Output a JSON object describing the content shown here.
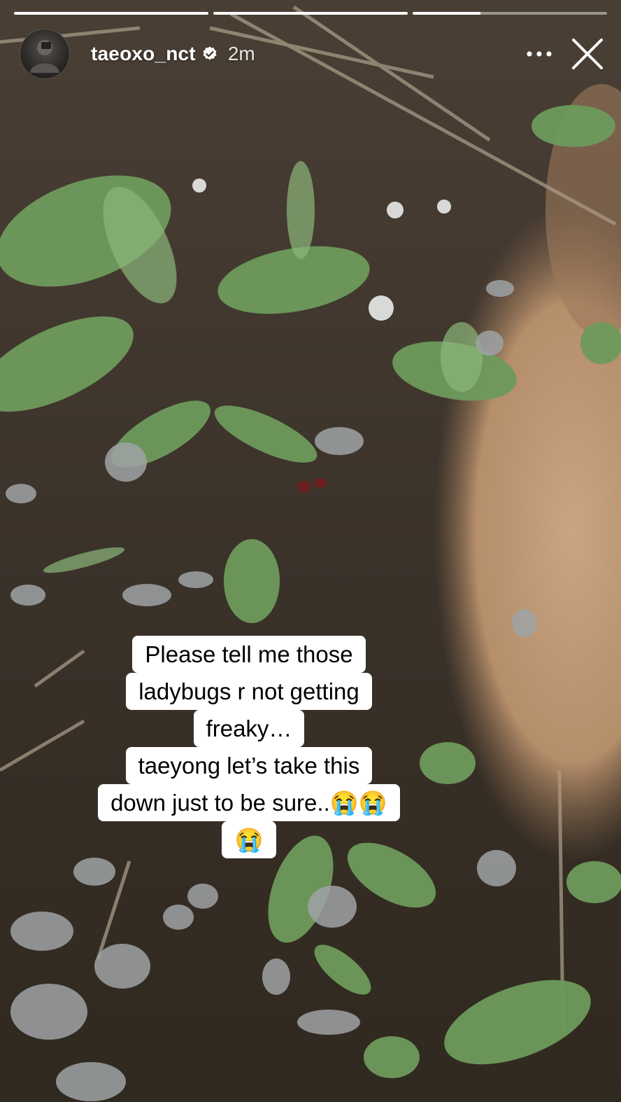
{
  "story": {
    "progress": [
      1,
      1,
      0.35
    ],
    "header": {
      "username": "taeoxo_nct",
      "verified": true,
      "timestamp": "2m",
      "avatar_icon": "profile-photo",
      "more_icon": "more-horizontal-icon",
      "close_icon": "close-icon"
    },
    "caption": {
      "lines": [
        "Please tell me those",
        "ladybugs r not getting",
        "freaky…",
        "taeyong let’s take this",
        "down just to be sure..😭😭",
        "😭"
      ]
    }
  },
  "colors": {
    "text": "#ffffff",
    "verified_badge": "#ffffff",
    "caption_bg": "#ffffff",
    "caption_text": "#000000"
  }
}
